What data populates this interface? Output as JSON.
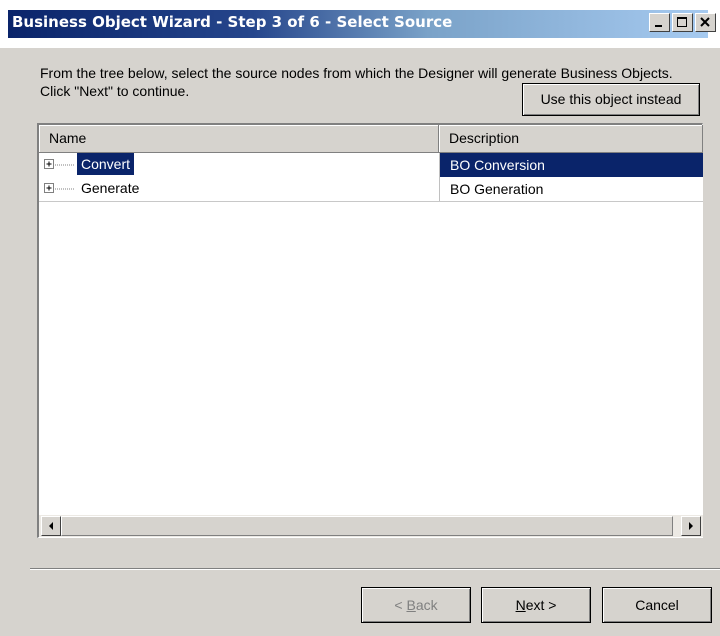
{
  "window": {
    "title": "Business Object Wizard - Step 3 of 6 - Select Source"
  },
  "instruction": "From the tree below, select the source nodes from which the Designer will generate Business Objects. Click \"Next\" to continue.",
  "use_object_button": "Use this object instead",
  "list": {
    "columns": [
      "Name",
      "Description"
    ],
    "rows": [
      {
        "name": "Convert",
        "description": "BO Conversion",
        "selected": true
      },
      {
        "name": "Generate",
        "description": "BO Generation",
        "selected": false
      }
    ]
  },
  "buttons": {
    "back_prefix": "< ",
    "back_accel": "B",
    "back_rest": "ack",
    "next_accel": "N",
    "next_rest": "ext >",
    "cancel": "Cancel"
  },
  "colors": {
    "selection": "#0a246a",
    "title_start": "#0a246a",
    "title_end": "#a6caf0",
    "face": "#d6d3ce"
  }
}
